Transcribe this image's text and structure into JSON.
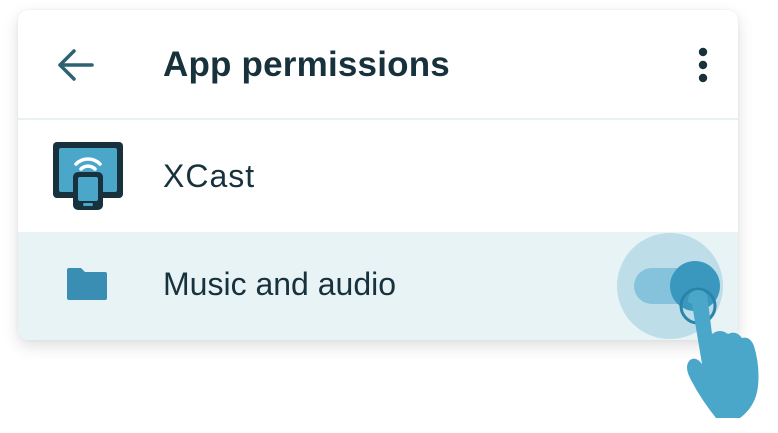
{
  "header": {
    "back_icon": "arrow-left-icon",
    "title": "App permissions",
    "more_icon": "more-vertical-icon"
  },
  "app": {
    "icon": "xcast-app-icon",
    "name": "XCast"
  },
  "permission": {
    "icon": "folder-icon",
    "label": "Music and audio",
    "toggle_state": "on"
  },
  "colors": {
    "title_text": "#17323c",
    "accent": "#3a98bf",
    "track": "#84c3db",
    "highlight_row": "#e8f3f6",
    "hand": "#4aa7c9"
  }
}
